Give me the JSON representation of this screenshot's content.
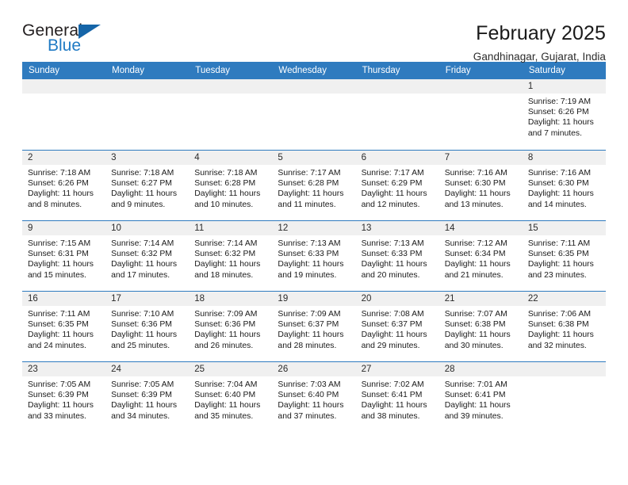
{
  "brand": {
    "word_top": "General",
    "word_bottom": "Blue",
    "triangle_color": "#1565a8",
    "blue_color": "#1f7ac4"
  },
  "header": {
    "title": "February 2025",
    "subtitle": "Gandhinagar, Gujarat, India",
    "accent_color": "#2f7bbf"
  },
  "weekday_headers": [
    "Sunday",
    "Monday",
    "Tuesday",
    "Wednesday",
    "Thursday",
    "Friday",
    "Saturday"
  ],
  "weeks": [
    [
      {
        "day": "",
        "empty": true
      },
      {
        "day": "",
        "empty": true
      },
      {
        "day": "",
        "empty": true
      },
      {
        "day": "",
        "empty": true
      },
      {
        "day": "",
        "empty": true
      },
      {
        "day": "",
        "empty": true
      },
      {
        "day": "1",
        "sunrise": "Sunrise: 7:19 AM",
        "sunset": "Sunset: 6:26 PM",
        "daylight_1": "Daylight: 11 hours",
        "daylight_2": "and 7 minutes."
      }
    ],
    [
      {
        "day": "2",
        "sunrise": "Sunrise: 7:18 AM",
        "sunset": "Sunset: 6:26 PM",
        "daylight_1": "Daylight: 11 hours",
        "daylight_2": "and 8 minutes."
      },
      {
        "day": "3",
        "sunrise": "Sunrise: 7:18 AM",
        "sunset": "Sunset: 6:27 PM",
        "daylight_1": "Daylight: 11 hours",
        "daylight_2": "and 9 minutes."
      },
      {
        "day": "4",
        "sunrise": "Sunrise: 7:18 AM",
        "sunset": "Sunset: 6:28 PM",
        "daylight_1": "Daylight: 11 hours",
        "daylight_2": "and 10 minutes."
      },
      {
        "day": "5",
        "sunrise": "Sunrise: 7:17 AM",
        "sunset": "Sunset: 6:28 PM",
        "daylight_1": "Daylight: 11 hours",
        "daylight_2": "and 11 minutes."
      },
      {
        "day": "6",
        "sunrise": "Sunrise: 7:17 AM",
        "sunset": "Sunset: 6:29 PM",
        "daylight_1": "Daylight: 11 hours",
        "daylight_2": "and 12 minutes."
      },
      {
        "day": "7",
        "sunrise": "Sunrise: 7:16 AM",
        "sunset": "Sunset: 6:30 PM",
        "daylight_1": "Daylight: 11 hours",
        "daylight_2": "and 13 minutes."
      },
      {
        "day": "8",
        "sunrise": "Sunrise: 7:16 AM",
        "sunset": "Sunset: 6:30 PM",
        "daylight_1": "Daylight: 11 hours",
        "daylight_2": "and 14 minutes."
      }
    ],
    [
      {
        "day": "9",
        "sunrise": "Sunrise: 7:15 AM",
        "sunset": "Sunset: 6:31 PM",
        "daylight_1": "Daylight: 11 hours",
        "daylight_2": "and 15 minutes."
      },
      {
        "day": "10",
        "sunrise": "Sunrise: 7:14 AM",
        "sunset": "Sunset: 6:32 PM",
        "daylight_1": "Daylight: 11 hours",
        "daylight_2": "and 17 minutes."
      },
      {
        "day": "11",
        "sunrise": "Sunrise: 7:14 AM",
        "sunset": "Sunset: 6:32 PM",
        "daylight_1": "Daylight: 11 hours",
        "daylight_2": "and 18 minutes."
      },
      {
        "day": "12",
        "sunrise": "Sunrise: 7:13 AM",
        "sunset": "Sunset: 6:33 PM",
        "daylight_1": "Daylight: 11 hours",
        "daylight_2": "and 19 minutes."
      },
      {
        "day": "13",
        "sunrise": "Sunrise: 7:13 AM",
        "sunset": "Sunset: 6:33 PM",
        "daylight_1": "Daylight: 11 hours",
        "daylight_2": "and 20 minutes."
      },
      {
        "day": "14",
        "sunrise": "Sunrise: 7:12 AM",
        "sunset": "Sunset: 6:34 PM",
        "daylight_1": "Daylight: 11 hours",
        "daylight_2": "and 21 minutes."
      },
      {
        "day": "15",
        "sunrise": "Sunrise: 7:11 AM",
        "sunset": "Sunset: 6:35 PM",
        "daylight_1": "Daylight: 11 hours",
        "daylight_2": "and 23 minutes."
      }
    ],
    [
      {
        "day": "16",
        "sunrise": "Sunrise: 7:11 AM",
        "sunset": "Sunset: 6:35 PM",
        "daylight_1": "Daylight: 11 hours",
        "daylight_2": "and 24 minutes."
      },
      {
        "day": "17",
        "sunrise": "Sunrise: 7:10 AM",
        "sunset": "Sunset: 6:36 PM",
        "daylight_1": "Daylight: 11 hours",
        "daylight_2": "and 25 minutes."
      },
      {
        "day": "18",
        "sunrise": "Sunrise: 7:09 AM",
        "sunset": "Sunset: 6:36 PM",
        "daylight_1": "Daylight: 11 hours",
        "daylight_2": "and 26 minutes."
      },
      {
        "day": "19",
        "sunrise": "Sunrise: 7:09 AM",
        "sunset": "Sunset: 6:37 PM",
        "daylight_1": "Daylight: 11 hours",
        "daylight_2": "and 28 minutes."
      },
      {
        "day": "20",
        "sunrise": "Sunrise: 7:08 AM",
        "sunset": "Sunset: 6:37 PM",
        "daylight_1": "Daylight: 11 hours",
        "daylight_2": "and 29 minutes."
      },
      {
        "day": "21",
        "sunrise": "Sunrise: 7:07 AM",
        "sunset": "Sunset: 6:38 PM",
        "daylight_1": "Daylight: 11 hours",
        "daylight_2": "and 30 minutes."
      },
      {
        "day": "22",
        "sunrise": "Sunrise: 7:06 AM",
        "sunset": "Sunset: 6:38 PM",
        "daylight_1": "Daylight: 11 hours",
        "daylight_2": "and 32 minutes."
      }
    ],
    [
      {
        "day": "23",
        "sunrise": "Sunrise: 7:05 AM",
        "sunset": "Sunset: 6:39 PM",
        "daylight_1": "Daylight: 11 hours",
        "daylight_2": "and 33 minutes."
      },
      {
        "day": "24",
        "sunrise": "Sunrise: 7:05 AM",
        "sunset": "Sunset: 6:39 PM",
        "daylight_1": "Daylight: 11 hours",
        "daylight_2": "and 34 minutes."
      },
      {
        "day": "25",
        "sunrise": "Sunrise: 7:04 AM",
        "sunset": "Sunset: 6:40 PM",
        "daylight_1": "Daylight: 11 hours",
        "daylight_2": "and 35 minutes."
      },
      {
        "day": "26",
        "sunrise": "Sunrise: 7:03 AM",
        "sunset": "Sunset: 6:40 PM",
        "daylight_1": "Daylight: 11 hours",
        "daylight_2": "and 37 minutes."
      },
      {
        "day": "27",
        "sunrise": "Sunrise: 7:02 AM",
        "sunset": "Sunset: 6:41 PM",
        "daylight_1": "Daylight: 11 hours",
        "daylight_2": "and 38 minutes."
      },
      {
        "day": "28",
        "sunrise": "Sunrise: 7:01 AM",
        "sunset": "Sunset: 6:41 PM",
        "daylight_1": "Daylight: 11 hours",
        "daylight_2": "and 39 minutes."
      },
      {
        "day": "",
        "empty": true
      }
    ]
  ]
}
